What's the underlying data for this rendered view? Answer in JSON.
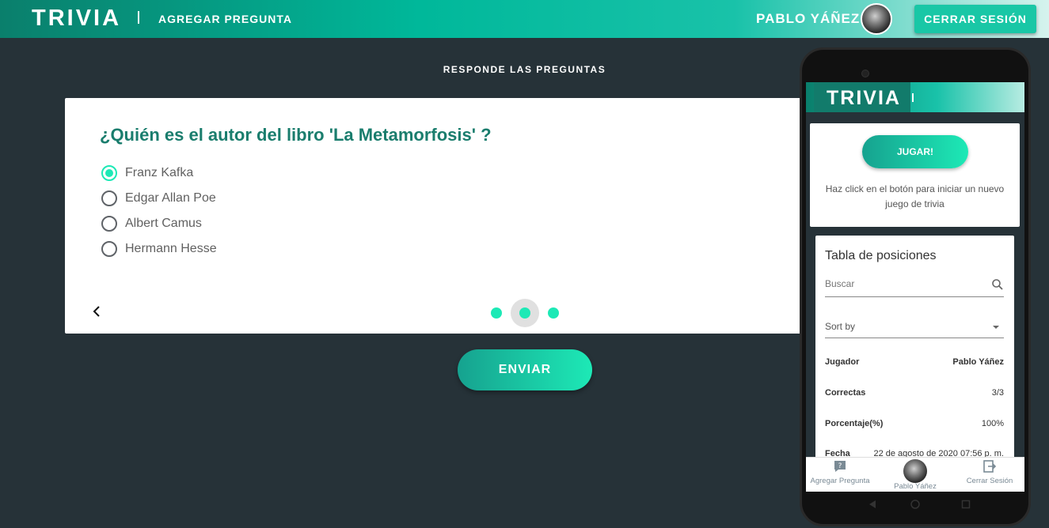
{
  "header": {
    "brand": "TRIVIA",
    "nav_add_question": "AGREGAR PREGUNTA",
    "username": "PABLO YÁÑEZ",
    "logout_label": "CERRAR SESIÓN"
  },
  "main": {
    "subtitle": "RESPONDE LAS PREGUNTAS",
    "question": "¿Quién es el autor del libro 'La Metamorfosis' ?",
    "options": [
      {
        "label": "Franz Kafka",
        "selected": true
      },
      {
        "label": "Edgar Allan Poe",
        "selected": false
      },
      {
        "label": "Albert Camus",
        "selected": false
      },
      {
        "label": "Hermann Hesse",
        "selected": false
      }
    ],
    "pagination": {
      "total": 3,
      "current": 2
    },
    "send_label": "ENVIAR"
  },
  "mobile": {
    "brand": "TRIVIA",
    "play_label": "JUGAR!",
    "play_description": "Haz click en el botón para iniciar un nuevo juego de trivia",
    "table_title": "Tabla de posiciones",
    "search_placeholder": "Buscar",
    "sort_label": "Sort by",
    "rows": [
      {
        "key": "Jugador",
        "value": "Pablo Yáñez"
      },
      {
        "key": "Correctas",
        "value": "3/3"
      },
      {
        "key": "Porcentaje(%)",
        "value": "100%"
      },
      {
        "key": "Fecha",
        "value": "22 de agosto de 2020 07:56 p. m."
      }
    ],
    "bottom_nav": {
      "add_question": "Agregar Pregunta",
      "user": "Pablo Yáñez",
      "logout": "Cerrar Sesión"
    }
  },
  "colors": {
    "accent": "#1de9b6",
    "brand_dark": "#0a7f6c",
    "background": "#263238",
    "question_text": "#1a7d6d"
  }
}
